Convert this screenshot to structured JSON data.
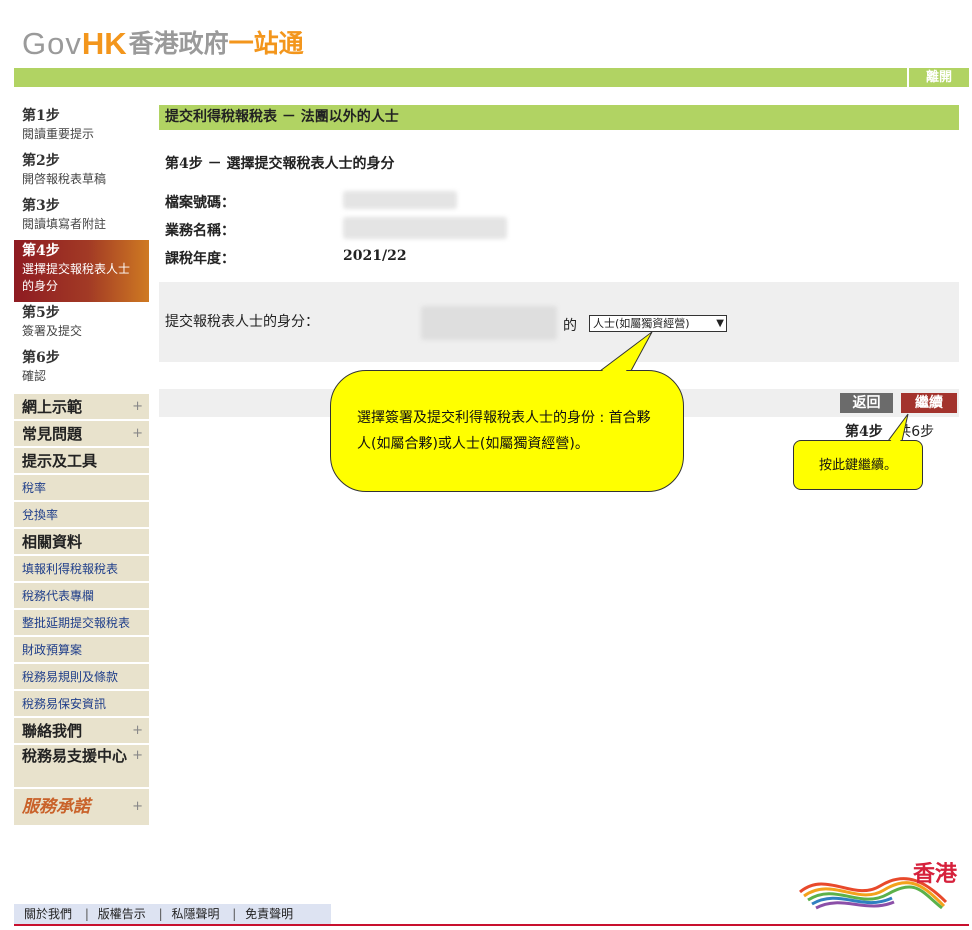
{
  "header": {
    "logo_gov": "Gov",
    "logo_hk": "HK",
    "logo_cn": "香港政府",
    "logo_cn2": "一站通",
    "logout": "離開"
  },
  "sidebar": {
    "steps": [
      {
        "num": "第1步",
        "desc": "閱讀重要提示"
      },
      {
        "num": "第2步",
        "desc": "開啓報稅表草稿"
      },
      {
        "num": "第3步",
        "desc": "閱讀填寫者附註"
      },
      {
        "num": "第4步",
        "desc": "選擇提交報稅表人士的身分"
      },
      {
        "num": "第5步",
        "desc": "簽署及提交"
      },
      {
        "num": "第6步",
        "desc": "確認"
      }
    ],
    "menu": {
      "online_demo": "網上示範",
      "faq": "常見問題",
      "tips_tools": "提示及工具",
      "tax_rate": "稅率",
      "exchange_rate": "兌換率",
      "related_info": "相關資料",
      "link1": "填報利得稅報稅表",
      "link2": "稅務代表專欄",
      "link3": "整批延期提交報稅表",
      "link4": "財政預算案",
      "link5": "稅務易規則及條款",
      "link6": "稅務易保安資訊",
      "contact": "聯絡我們",
      "support": "稅務易支援中心",
      "pledge": "服務承諾",
      "plus": "+"
    }
  },
  "main": {
    "title": "提交利得稅報稅表 － 法團以外的人士",
    "step_title": "第4步 － 選擇提交報稅表人士的身分",
    "file_no_label": "檔案號碼：",
    "business_name_label": "業務名稱：",
    "year_label": "課稅年度：",
    "year_value": "2021/22",
    "identity_label": "提交報稅表人士的身分：",
    "de": "的",
    "identity_selected": "人士(如屬獨資經營)",
    "back": "返回",
    "next": "繼續",
    "step_current": "第4步",
    "step_total": "共6步"
  },
  "callouts": {
    "identity_tip": "選擇簽署及提交利得報稅表人士的身份 : 首合夥人(如屬合夥)或人士(如屬獨資經營)。",
    "next_tip": "按此鍵繼續。"
  },
  "footer": {
    "about": "關於我們",
    "copyright": "版權告示",
    "privacy": "私隱聲明",
    "disclaimer": "免責聲明",
    "sep": "|",
    "brand": "香港"
  },
  "colors": {
    "green": "#b1d363",
    "orange": "#f3961c",
    "active_step": "#8e1b22",
    "callout": "#ffff00",
    "next_button": "#a3332d"
  }
}
